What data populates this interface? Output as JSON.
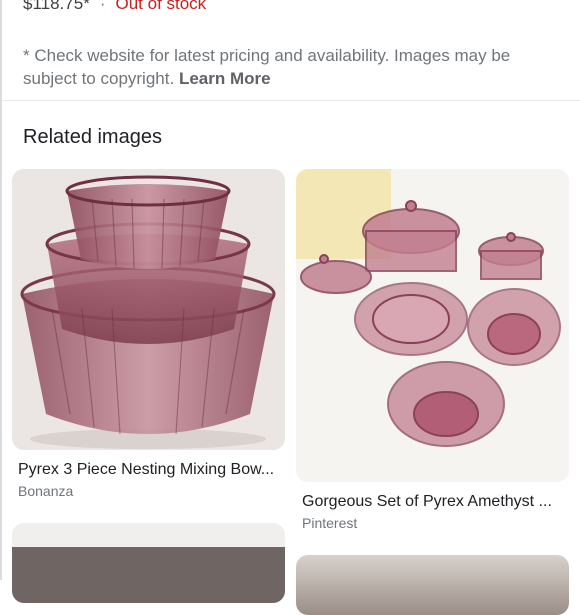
{
  "product": {
    "price": "$118.75*",
    "separator": "·",
    "stock_status": "Out of stock"
  },
  "disclaimer": {
    "text": "* Check website for latest pricing and availability. Images may be subject to copyright.",
    "link_label": "Learn More"
  },
  "related": {
    "title": "Related images",
    "items": [
      {
        "title": "Pyrex 3 Piece Nesting Mixing Bow...",
        "source": "Bonanza"
      },
      {
        "title": "Gorgeous Set of Pyrex Amethyst ...",
        "source": "Pinterest"
      }
    ]
  },
  "colors": {
    "stock_status": "#c5221f",
    "muted_text": "#70757a",
    "amethyst_glass": "#a7546c"
  }
}
